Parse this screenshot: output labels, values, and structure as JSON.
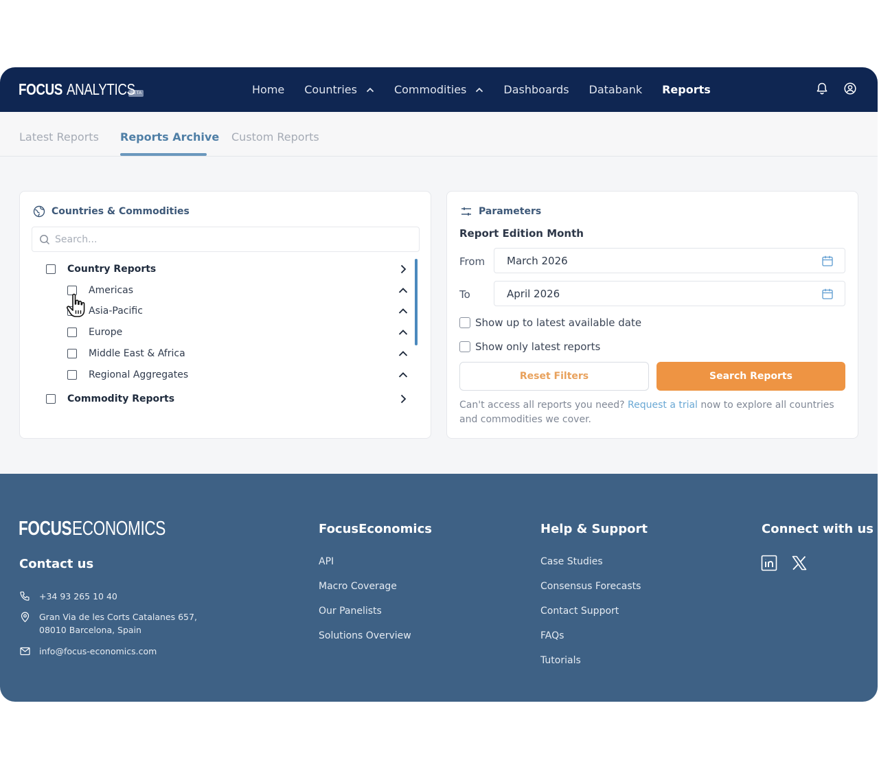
{
  "brand": {
    "part1": "FOCUS",
    "part2": "ANALYTICS",
    "badge": "BETA"
  },
  "nav": {
    "home": "Home",
    "countries": "Countries",
    "commodities": "Commodities",
    "dashboards": "Dashboards",
    "databank": "Databank",
    "reports": "Reports"
  },
  "icons": {
    "notifications": "bell-icon",
    "account": "user-icon"
  },
  "tabs": {
    "latest": "Latest Reports",
    "archive": "Reports Archive",
    "custom": "Custom Reports"
  },
  "left": {
    "title": "Countries & Commodities",
    "search_placeholder": "Search...",
    "country_reports": "Country Reports",
    "regions": [
      "Americas",
      "Asia-Pacific",
      "Europe",
      "Middle East & Africa",
      "Regional Aggregates"
    ],
    "commodity_reports": "Commodity Reports"
  },
  "right": {
    "title": "Parameters",
    "subtitle": "Report Edition Month",
    "from_label": "From",
    "from_value": "March 2026",
    "to_label": "To",
    "to_value": "April 2026",
    "opt_latest_date": "Show up to latest available date",
    "opt_latest_reports": "Show only latest reports",
    "reset": "Reset Filters",
    "search": "Search Reports",
    "note_pre": "Can't access all reports you need? ",
    "note_link": "Request a trial",
    "note_post": " now to explore all countries and commodities we cover."
  },
  "footer": {
    "brand1": "FOCUS",
    "brand2": "ECONOMICS",
    "contact_title": "Contact us",
    "phone": "+34 93 265 10 40",
    "address1": "Gran Via de les Corts Catalanes 657,",
    "address2": "08010 Barcelona, Spain",
    "email": "info@focus-economics.com",
    "col1_title": "FocusEconomics",
    "col1_links": [
      "API",
      "Macro Coverage",
      "Our Panelists",
      "Solutions Overview"
    ],
    "col2_title": "Help & Support",
    "col2_links": [
      "Case Studies",
      "Consensus Forecasts",
      "Contact Support",
      "FAQs",
      "Tutorials"
    ],
    "col3_title": "Connect with us",
    "social": [
      "linkedin-icon",
      "x-icon"
    ]
  },
  "colors": {
    "nav_bg": "#0f2652",
    "accent": "#ee9443",
    "tab_active": "#4f7fa6",
    "footer_bg": "#3e6185"
  }
}
